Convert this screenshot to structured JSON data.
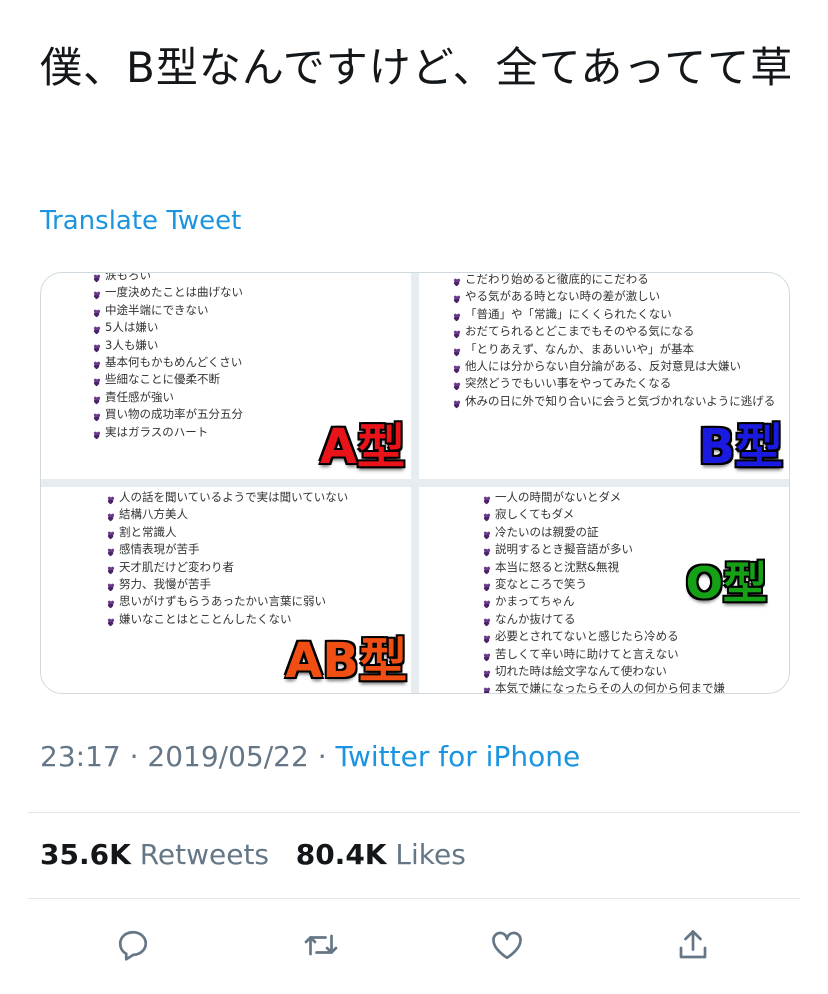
{
  "tweet": {
    "text": "僕、B型なんですけど、全てあってて草",
    "translate_label": "Translate Tweet",
    "time": "23:17",
    "date": "2019/05/22",
    "source": "Twitter for iPhone",
    "separator": "·"
  },
  "stats": {
    "retweets_count": "35.6K",
    "retweets_label": "Retweets",
    "likes_count": "80.4K",
    "likes_label": "Likes"
  },
  "media": {
    "a": {
      "badge": "A型",
      "badge_color": "#e8141a",
      "lines": [
        "涙もろい",
        "一度決めたことは曲げない",
        "中途半端にできない",
        "5人は嫌い",
        "3人も嫌い",
        "基本何もかもめんどくさい",
        "些細なことに優柔不断",
        "責任感が強い",
        "買い物の成功率が五分五分",
        "実はガラスのハート"
      ]
    },
    "b": {
      "badge": "B型",
      "badge_color": "#1a1ae0",
      "lines": [
        "こだわり始めると徹底的にこだわる",
        "やる気がある時とない時の差が激しい",
        "「普通」や「常識」にくくられたくない",
        "おだてられるとどこまでもそのやる気になる",
        "「とりあえず、なんか、まあいいや」が基本",
        "他人には分からない自分論がある、反対意見は大嫌い",
        "突然どうでもいい事をやってみたくなる",
        "休みの日に外で知り合いに会うと気づかれないように逃げる"
      ]
    },
    "ab": {
      "badge": "AB型",
      "badge_color": "#f04e12",
      "lines": [
        "人の話を聞いているようで実は聞いていない",
        "結構八方美人",
        "割と常識人",
        "感情表現が苦手",
        "天才肌だけど変わり者",
        "努力、我慢が苦手",
        "思いがけずもらうあったかい言葉に弱い",
        "嫌いなことはとことんしたくない"
      ]
    },
    "o": {
      "badge": "O型",
      "badge_color": "#16a016",
      "lines": [
        "一人の時間がないとダメ",
        "寂しくてもダメ",
        "冷たいのは親愛の証",
        "説明するとき擬音語が多い",
        "本当に怒ると沈黙&無視",
        "変なところで笑う",
        "かまってちゃん",
        "なんか抜けてる",
        "必要とされてないと感じたら冷める",
        "苦しくて辛い時に助けてと言えない",
        "切れた時は絵文字なんて使わない",
        "本気で嫌になったらその人の何から何まで嫌"
      ]
    }
  },
  "icons": {
    "reply": "reply-icon",
    "retweet": "retweet-icon",
    "like": "like-icon",
    "share": "share-icon",
    "bullet": "heart-bullet-icon"
  },
  "colors": {
    "link": "#1b95e0",
    "muted": "#657786",
    "bullet": "#6b3b8c"
  }
}
